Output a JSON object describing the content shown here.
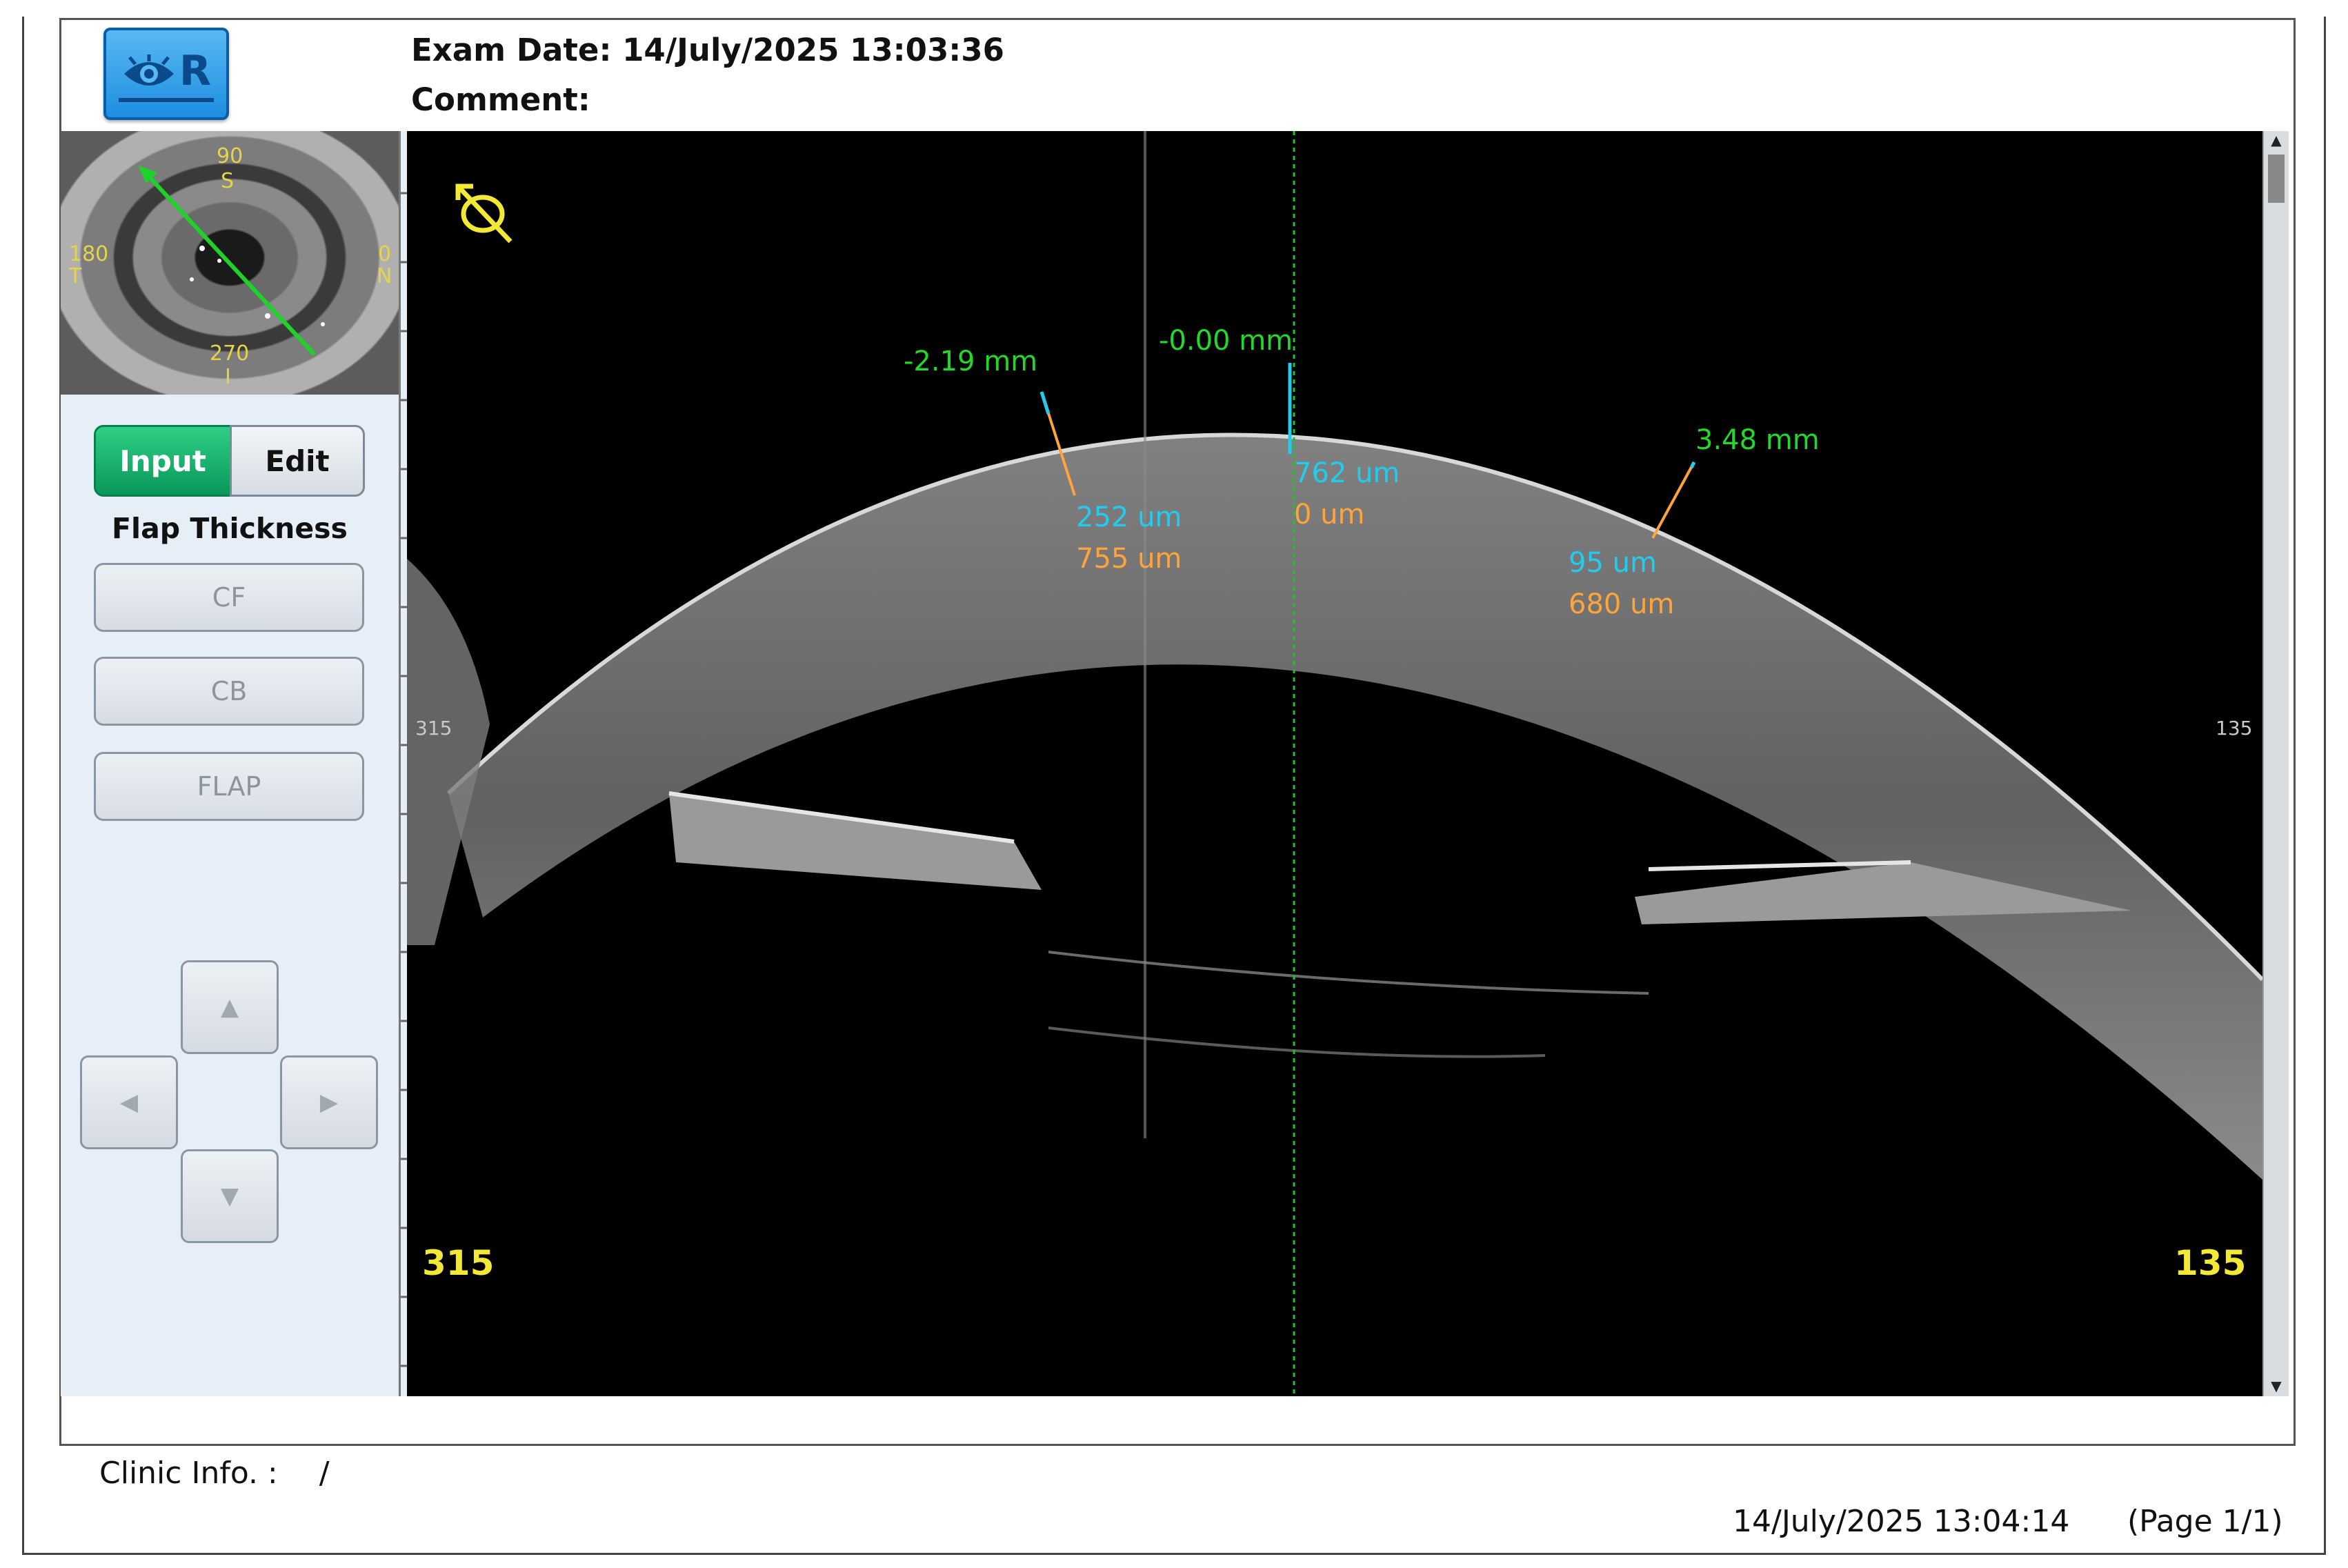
{
  "header": {
    "eye_side": "R",
    "exam_date_label": "Exam Date:",
    "exam_date_value": "14/July/2025 13:03:36",
    "comment_label": "Comment:",
    "comment_value": ""
  },
  "thumbnail": {
    "labels": {
      "top_deg": "90",
      "top_dir": "S",
      "left_deg": "180",
      "left_dir": "T",
      "right_deg": "0",
      "right_dir": "N",
      "bottom_deg": "270",
      "bottom_dir": "I"
    }
  },
  "mode_toggle": {
    "input_label": "Input",
    "edit_label": "Edit",
    "active": "Input"
  },
  "flap_section": {
    "title": "Flap Thickness",
    "buttons": [
      "CF",
      "CB",
      "FLAP"
    ]
  },
  "nav": {
    "up": "▲",
    "down": "▼",
    "left": "◀",
    "right": "▶"
  },
  "scan": {
    "left_angle": "315",
    "right_angle": "135",
    "left_angle_small": "315",
    "right_angle_small": "135",
    "measurements": [
      {
        "position_label": "-2.19 mm",
        "flap_value": "252 um",
        "total_value": "755 um"
      },
      {
        "position_label": "-0.00 mm",
        "flap_value": "762 um",
        "total_value": "0 um"
      },
      {
        "position_label": "3.48 mm",
        "flap_value": "95 um",
        "total_value": "680 um"
      }
    ],
    "colors": {
      "position": "#22d82a",
      "flap": "#22ccee",
      "total": "#ffa43a",
      "angle": "#f3e935"
    }
  },
  "footer": {
    "clinic_label": "Clinic Info. :",
    "clinic_value": "/",
    "print_date": "14/July/2025 13:04:14",
    "page": "(Page 1/1)"
  }
}
